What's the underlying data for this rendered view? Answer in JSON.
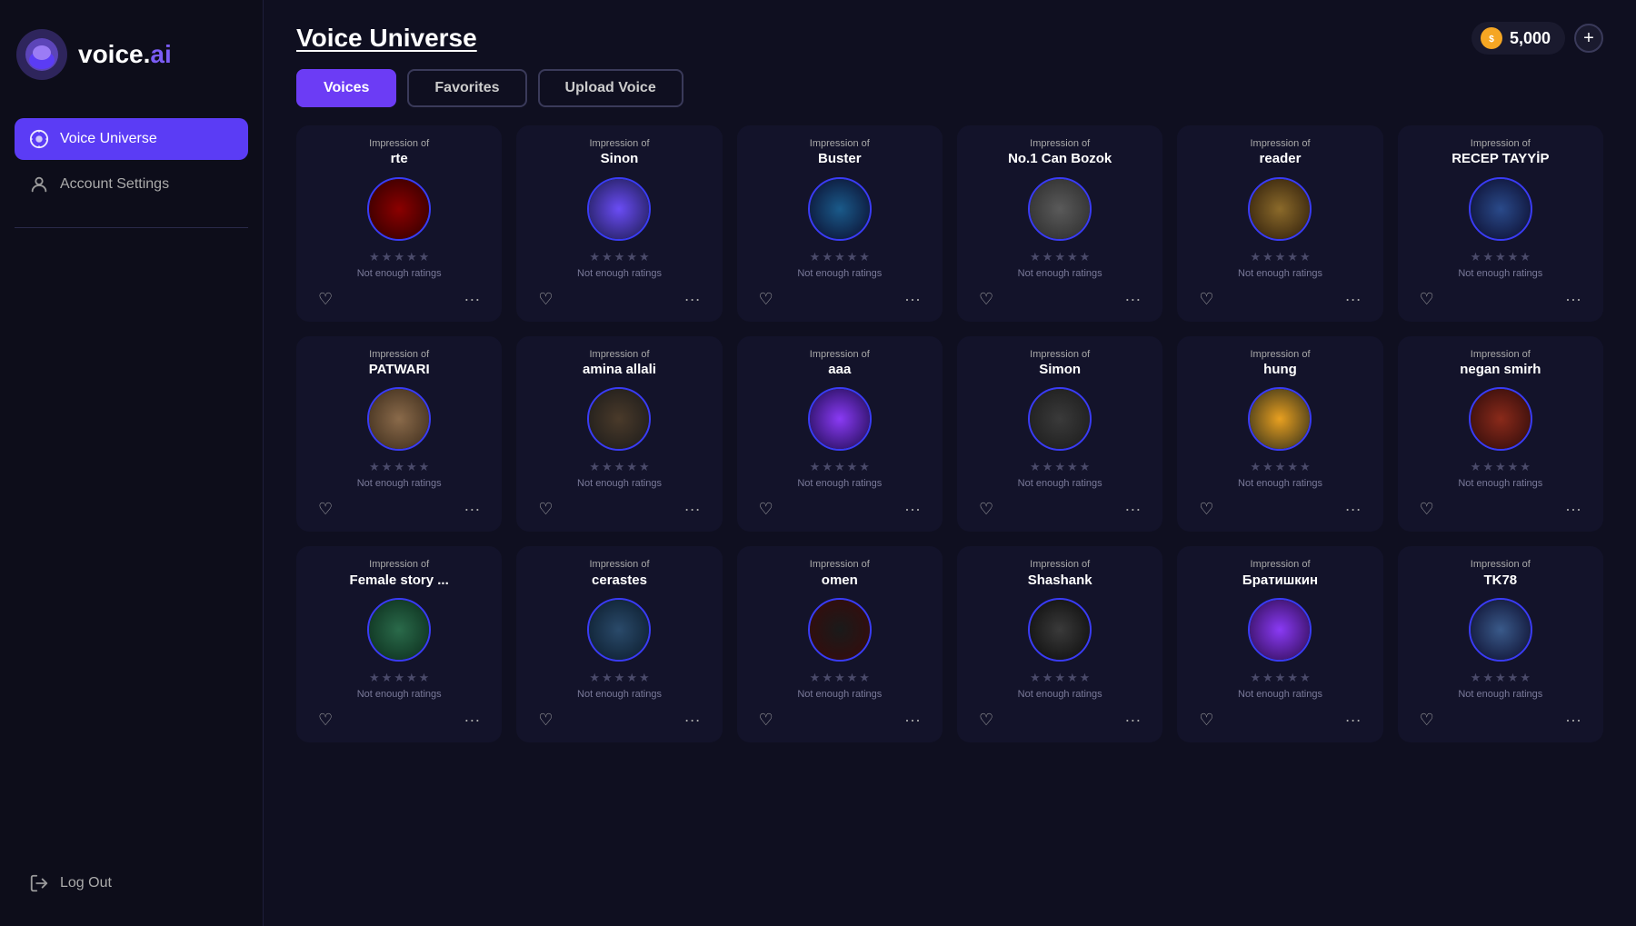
{
  "app": {
    "logo_text_main": "voice.",
    "logo_text_accent": "ai"
  },
  "sidebar": {
    "nav_items": [
      {
        "id": "voice-universe",
        "label": "Voice Universe",
        "active": true
      },
      {
        "id": "account-settings",
        "label": "Account Settings",
        "active": false
      }
    ],
    "logout_label": "Log Out"
  },
  "header": {
    "page_title": "Voice Universe",
    "coins_value": "5,000",
    "coins_label": "5,000"
  },
  "tabs": [
    {
      "id": "voices",
      "label": "Voices",
      "active": true
    },
    {
      "id": "favorites",
      "label": "Favorites",
      "active": false
    },
    {
      "id": "upload-voice",
      "label": "Upload Voice",
      "active": false
    }
  ],
  "voices": [
    {
      "id": "rte",
      "impression_label": "Impression of",
      "name": "rte",
      "not_enough": "Not enough ratings",
      "avatar_class": "avatar-rte"
    },
    {
      "id": "sinon",
      "impression_label": "Impression of",
      "name": "Sinon",
      "not_enough": "Not enough ratings",
      "avatar_class": "avatar-sinon"
    },
    {
      "id": "buster",
      "impression_label": "Impression of",
      "name": "Buster",
      "not_enough": "Not enough ratings",
      "avatar_class": "avatar-buster"
    },
    {
      "id": "no1-can-bozok",
      "impression_label": "Impression of",
      "name": "No.1 Can Bozok",
      "not_enough": "Not enough ratings",
      "avatar_class": "avatar-no1"
    },
    {
      "id": "reader",
      "impression_label": "Impression of",
      "name": "reader",
      "not_enough": "Not enough ratings",
      "avatar_class": "avatar-reader"
    },
    {
      "id": "recep-tayyip",
      "impression_label": "Impression of",
      "name": "RECEP TAYYİP",
      "not_enough": "Not enough ratings",
      "avatar_class": "avatar-recep"
    },
    {
      "id": "patwari",
      "impression_label": "Impression of",
      "name": "PATWARI",
      "not_enough": "Not enough ratings",
      "avatar_class": "avatar-patwari"
    },
    {
      "id": "amina-allali",
      "impression_label": "Impression of",
      "name": "amina allali",
      "not_enough": "Not enough ratings",
      "avatar_class": "avatar-amina"
    },
    {
      "id": "aaa",
      "impression_label": "Impression of",
      "name": "aaa",
      "not_enough": "Not enough ratings",
      "avatar_class": "avatar-aaa"
    },
    {
      "id": "simon",
      "impression_label": "Impression of",
      "name": "Simon",
      "not_enough": "Not enough ratings",
      "avatar_class": "avatar-simon"
    },
    {
      "id": "hung",
      "impression_label": "Impression of",
      "name": "hung",
      "not_enough": "Not enough ratings",
      "avatar_class": "avatar-hung"
    },
    {
      "id": "negan-smirh",
      "impression_label": "Impression of",
      "name": "negan smirh",
      "not_enough": "Not enough ratings",
      "avatar_class": "avatar-negan"
    },
    {
      "id": "female-story",
      "impression_label": "Impression of",
      "name": "Female story ...",
      "not_enough": "Not enough ratings",
      "avatar_class": "avatar-female"
    },
    {
      "id": "cerastes",
      "impression_label": "Impression of",
      "name": "cerastes",
      "not_enough": "Not enough ratings",
      "avatar_class": "avatar-cerastes"
    },
    {
      "id": "omen",
      "impression_label": "Impression of",
      "name": "omen",
      "not_enough": "Not enough ratings",
      "avatar_class": "avatar-omen"
    },
    {
      "id": "shashank",
      "impression_label": "Impression of",
      "name": "Shashank",
      "not_enough": "Not enough ratings",
      "avatar_class": "avatar-shashank"
    },
    {
      "id": "bratishkin",
      "impression_label": "Impression of",
      "name": "Братишкин",
      "not_enough": "Not enough ratings",
      "avatar_class": "avatar-bratishkin"
    },
    {
      "id": "tk78",
      "impression_label": "Impression of",
      "name": "TK78",
      "not_enough": "Not enough ratings",
      "avatar_class": "avatar-tk78"
    }
  ],
  "ui": {
    "heart_icon": "♡",
    "more_icon": "···",
    "star_icon": "★",
    "coin_symbol": "●",
    "add_symbol": "+"
  }
}
